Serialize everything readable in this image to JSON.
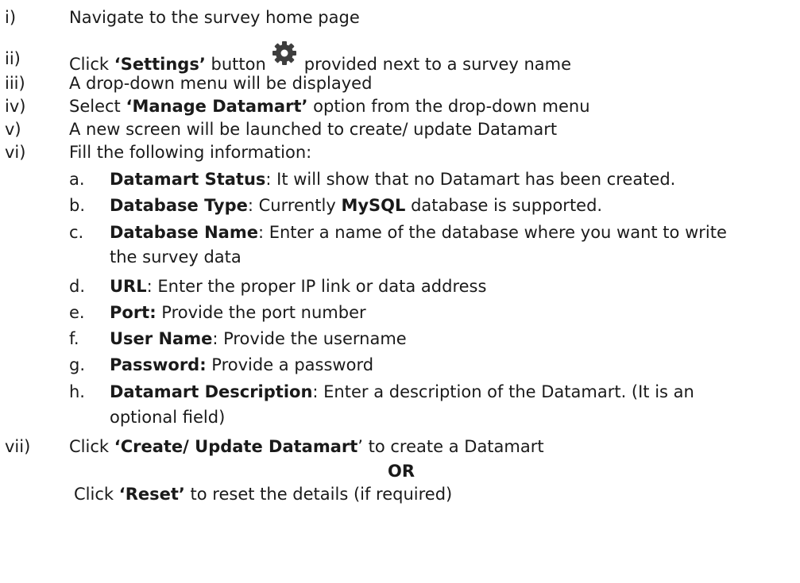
{
  "steps": [
    {
      "num": "i)",
      "text": "Navigate to the survey home page"
    },
    {
      "num": "ii)",
      "pre": "Click ",
      "bold": "‘Settings’",
      "mid": " button",
      "icon": "gear-icon",
      "post": "provided next to a survey name"
    },
    {
      "num": "iii)",
      "text": "A drop-down menu will be displayed"
    },
    {
      "num": "iv)",
      "pre": "Select ",
      "bold": "‘Manage Datamart’",
      "post": " option from the drop-down menu"
    },
    {
      "num": "v)",
      "text": "A new screen will be launched to create/ update Datamart"
    },
    {
      "num": "vi)",
      "text": "Fill the following information:"
    }
  ],
  "fields": [
    {
      "letter": "a.",
      "label": "Datamart Status",
      "text": ": It will show that no Datamart has been created."
    },
    {
      "letter": "b.",
      "label": "Database Type",
      "text": ": Currently ",
      "bold2": "MySQL",
      "text2": " database is supported."
    },
    {
      "letter": "c.",
      "label": "Database Name",
      "text": ": Enter a name of the database where you want to write",
      "cont": "the survey data"
    },
    {
      "letter": "d.",
      "label": "URL",
      "text": ": Enter the proper IP link or data address"
    },
    {
      "letter": "e.",
      "label": "Port:",
      "text": " Provide the port number"
    },
    {
      "letter": "f.",
      "label": "User Name",
      "text": ": Provide the username"
    },
    {
      "letter": "g.",
      "label": "Password:",
      "text": " Provide a password"
    },
    {
      "letter": "h.",
      "label": "Datamart Description",
      "text": ": Enter a description of the Datamart. (It is an",
      "cont": "optional field)"
    }
  ],
  "final": {
    "num": "vii)",
    "pre": "Click ",
    "bold": "‘Create/ Update Datamart",
    "post": "’ to create a Datamart",
    "or": "OR",
    "reset_pre": "Click ",
    "reset_bold": "‘Reset’",
    "reset_post": " to reset the details (if required)"
  },
  "colors": {
    "gear": "#3e3e3e",
    "text": "#1a1a1a"
  }
}
